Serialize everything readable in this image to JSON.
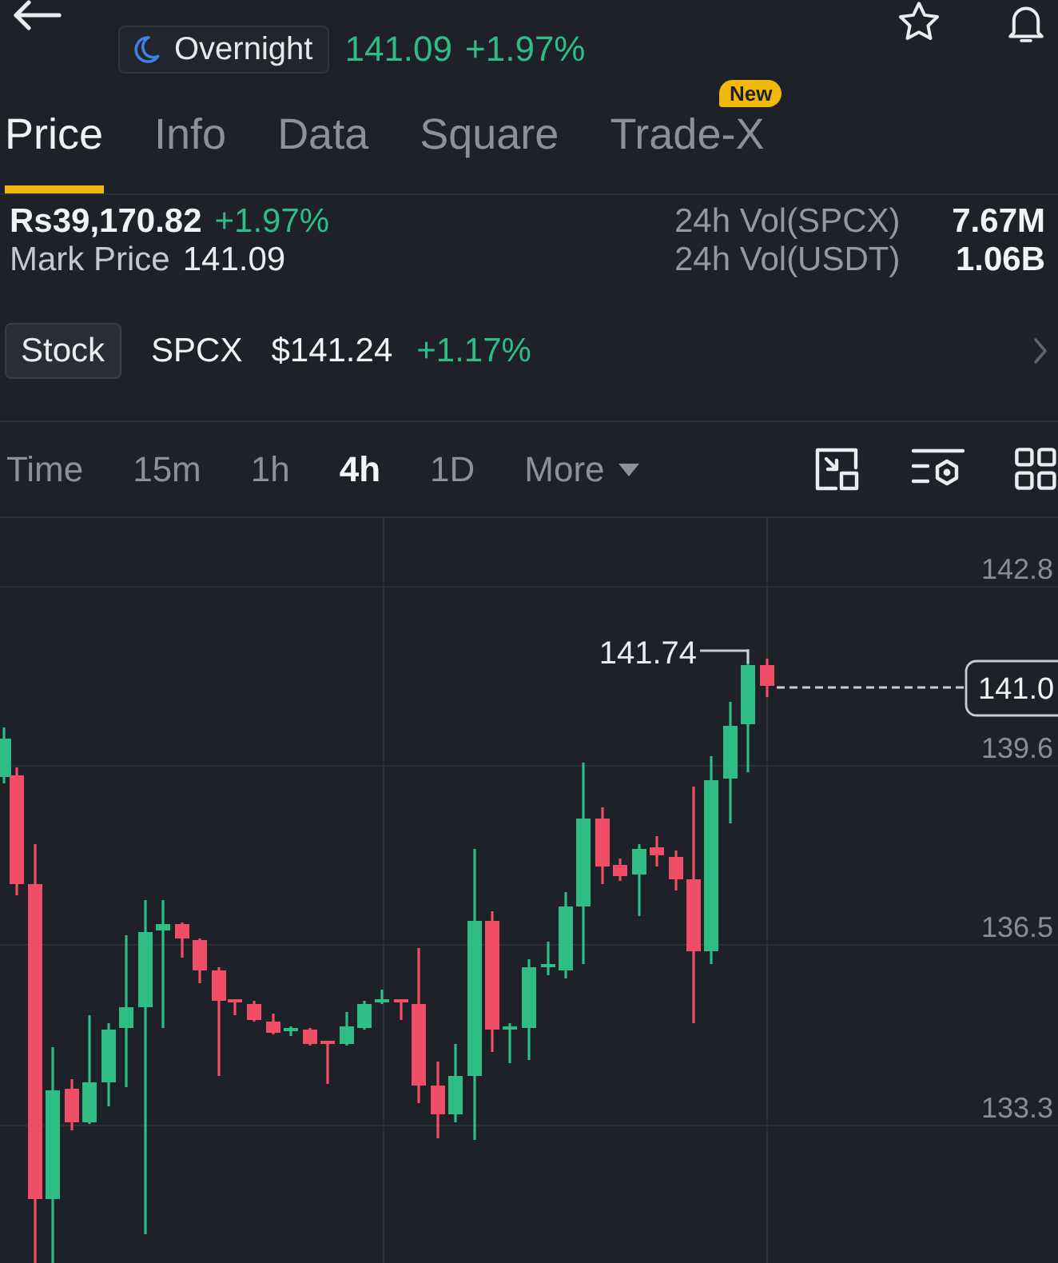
{
  "header": {
    "session": {
      "label": "Overnight"
    },
    "last_price": "141.09",
    "change": "+1.97%"
  },
  "tabs": [
    {
      "label": "Price",
      "selected": true
    },
    {
      "label": "Info",
      "selected": false
    },
    {
      "label": "Data",
      "selected": false
    },
    {
      "label": "Square",
      "selected": false
    },
    {
      "label": "Trade-X",
      "selected": false,
      "badge": "New"
    }
  ],
  "stats": {
    "left": [
      {
        "kind": "quote",
        "value": "Rs39,170.82",
        "change": "+1.97%"
      },
      {
        "kind": "field",
        "label": "Mark Price",
        "value": "141.09"
      }
    ],
    "right": [
      {
        "label": "24h Vol(SPCX)",
        "value": "7.67M"
      },
      {
        "label": "24h Vol(USDT)",
        "value": "1.06B"
      }
    ]
  },
  "stock": {
    "tag": "Stock",
    "symbol": "SPCX",
    "price": "$141.24",
    "change": "+1.17%"
  },
  "intervals": [
    {
      "label": "Time",
      "kind": "option",
      "selected": false
    },
    {
      "label": "15m",
      "kind": "option",
      "selected": false
    },
    {
      "label": "1h",
      "kind": "option",
      "selected": false
    },
    {
      "label": "4h",
      "kind": "option",
      "selected": true
    },
    {
      "label": "1D",
      "kind": "option",
      "selected": false
    },
    {
      "label": "More",
      "kind": "menu",
      "selected": false
    }
  ],
  "chart": {
    "price_labels": [
      "142.8",
      "139.6",
      "136.5",
      "133.3"
    ],
    "last_price_tag": "141.0",
    "high_label": "141.74"
  }
}
